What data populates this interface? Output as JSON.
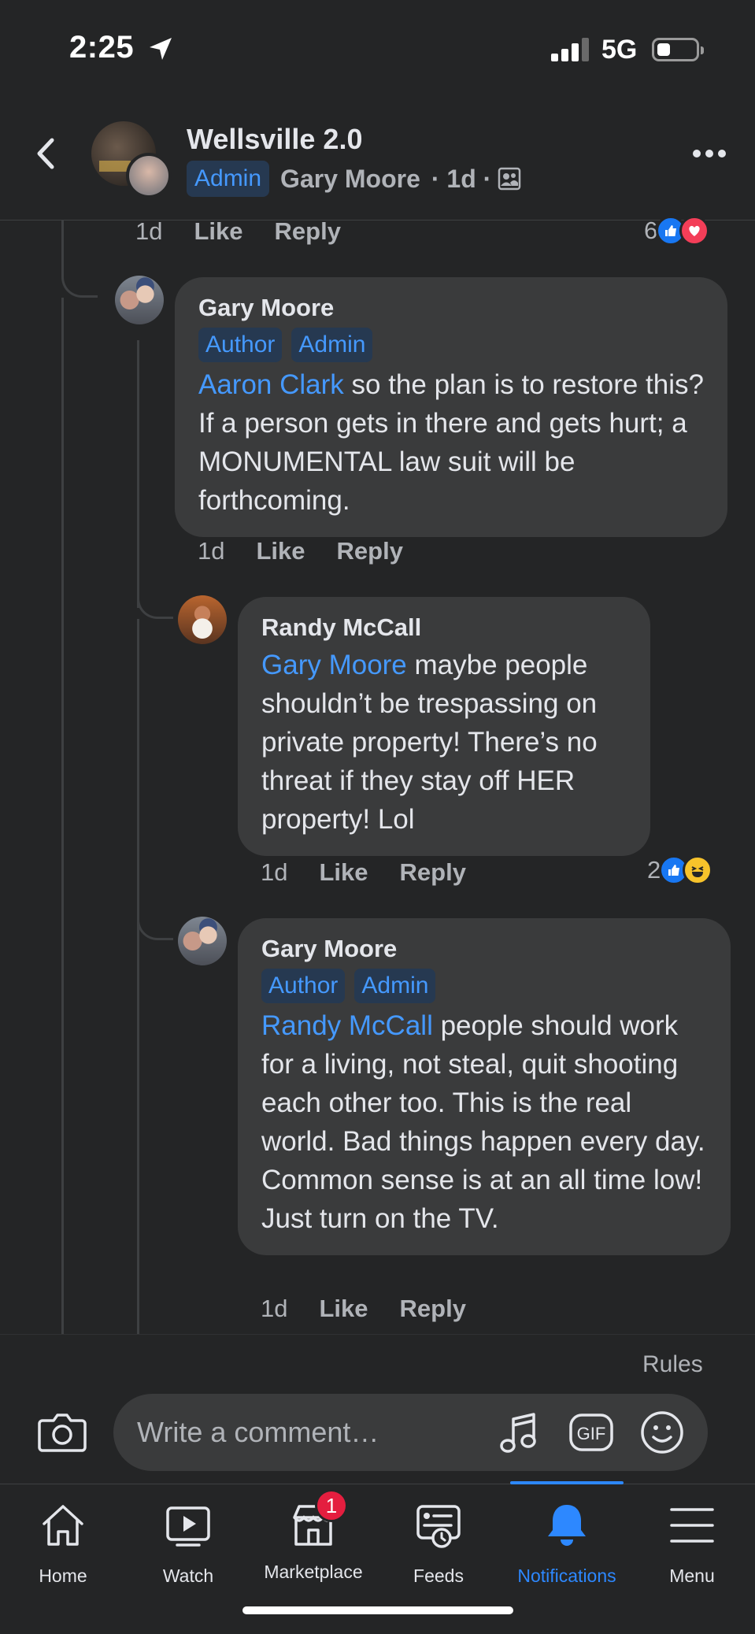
{
  "status": {
    "time": "2:25",
    "network": "5G"
  },
  "header": {
    "group_name": "Wellsville 2.0",
    "role_badge": "Admin",
    "poster": "Gary Moore",
    "age": "· 1d ·"
  },
  "previous_comment": {
    "time": "1d",
    "like": "Like",
    "reply": "Reply",
    "reaction_count": "6"
  },
  "comments": [
    {
      "author": "Gary Moore",
      "badges": [
        "Author",
        "Admin"
      ],
      "mention": "Aaron Clark",
      "text": " so the plan is to restore this? If a person gets in there and gets hurt; a MONUMENTAL law suit will be forthcoming.",
      "time": "1d",
      "like": "Like",
      "reply": "Reply"
    },
    {
      "author": "Randy McCall",
      "mention": "Gary Moore",
      "text": " maybe people shouldn’t be trespassing on private property! There’s no threat if they stay off HER property! Lol",
      "time": "1d",
      "like": "Like",
      "reply": "Reply",
      "reaction_count": "2"
    },
    {
      "author": "Gary Moore",
      "badges": [
        "Author",
        "Admin"
      ],
      "mention": "Randy McCall",
      "text": " people should work for a living, not steal, quit shooting each other too. This is the real world. Bad things happen every day. Common sense is at an all time low! Just turn on the TV.",
      "time": "1d",
      "like": "Like",
      "reply": "Reply"
    }
  ],
  "composer": {
    "rules": "Rules",
    "placeholder": "Write a comment…",
    "gif": "GIF"
  },
  "tabs": [
    {
      "label": "Home",
      "icon": "home-icon"
    },
    {
      "label": "Watch",
      "icon": "watch-icon"
    },
    {
      "label": "Marketplace",
      "icon": "marketplace-icon",
      "badge": "1"
    },
    {
      "label": "Feeds",
      "icon": "feeds-icon"
    },
    {
      "label": "Notifications",
      "icon": "bell-icon",
      "active": true
    },
    {
      "label": "Menu",
      "icon": "menu-icon"
    }
  ],
  "colors": {
    "background": "#242526",
    "bubble": "#3a3b3c",
    "accent": "#2d88ff",
    "mention": "#4599ff",
    "badge_bg": "#263951"
  }
}
